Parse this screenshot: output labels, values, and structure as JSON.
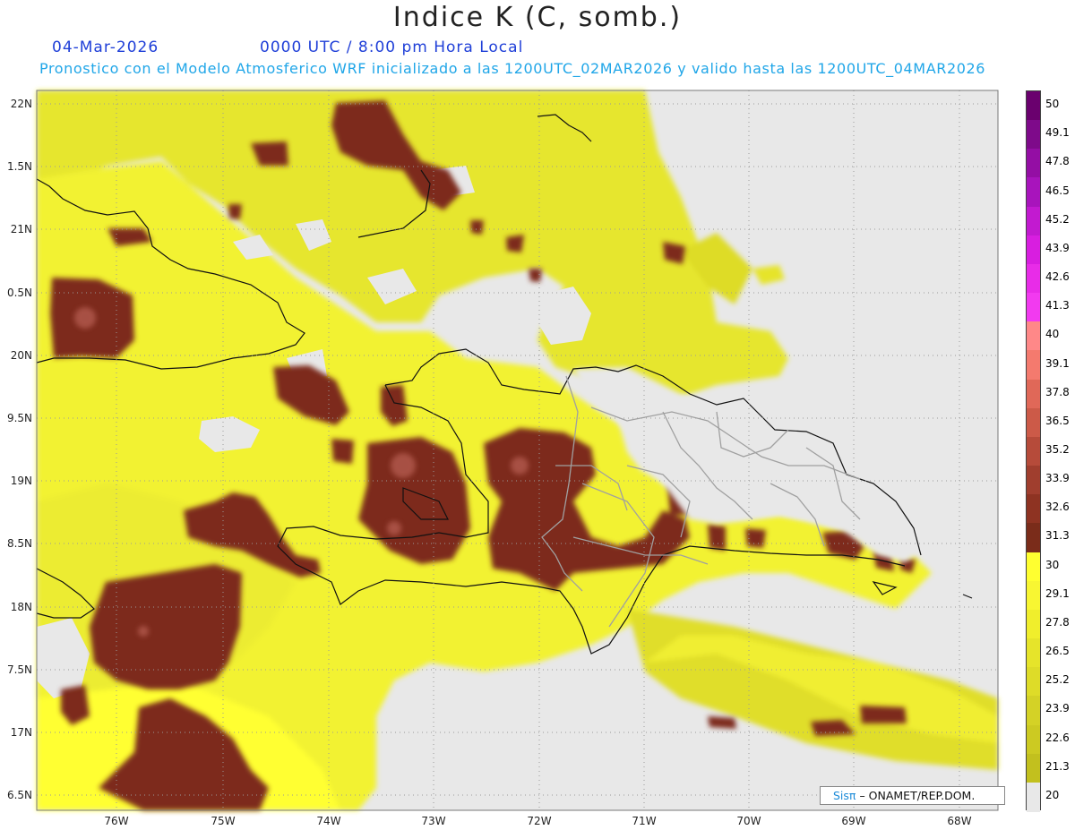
{
  "header": {
    "title": "Indice K (C, somb.)",
    "date": "04-Mar-2026",
    "time": "0000 UTC / 8:00 pm Hora Local",
    "subtitle": "Pronostico con el Modelo Atmosferico WRF inicializado a las 1200UTC_02MAR2026 y valido hasta las  1200UTC_04MAR2026"
  },
  "map": {
    "lat_labels": [
      "22N",
      "1.5N",
      "21N",
      "0.5N",
      "20N",
      "9.5N",
      "19N",
      "8.5N",
      "18N",
      "7.5N",
      "17N",
      "6.5N"
    ],
    "lon_labels": [
      "76W",
      "75W",
      "74W",
      "73W",
      "72W",
      "71W",
      "70W",
      "69W",
      "68W"
    ],
    "background_color": "#e8e8e8",
    "grid": "dotted"
  },
  "colorbar": {
    "labels": [
      "50",
      "49.1",
      "47.8",
      "46.5",
      "45.2",
      "43.9",
      "42.6",
      "41.3",
      "40",
      "39.1",
      "37.8",
      "36.5",
      "35.2",
      "33.9",
      "32.6",
      "31.3",
      "30",
      "29.1",
      "27.8",
      "26.5",
      "25.2",
      "23.9",
      "22.6",
      "21.3",
      "20"
    ],
    "colors": [
      "#6a006e",
      "#7e0a8a",
      "#940ea4",
      "#a814bc",
      "#c21ad0",
      "#d81ee0",
      "#e82ce8",
      "#f23af0",
      "#ff8888",
      "#f47a6e",
      "#e06858",
      "#cc5a48",
      "#b64b3a",
      "#a03e2e",
      "#8e3322",
      "#7a2c1a",
      "#ffff30",
      "#f8f632",
      "#f0ee2c",
      "#e6e42a",
      "#dedc28",
      "#d4d226",
      "#ccca22",
      "#c2c01e",
      "#e8e8e8"
    ]
  },
  "credit": {
    "brand": "Sis",
    "pi": "π",
    "text": "– ONAMET/REP.DOM."
  }
}
